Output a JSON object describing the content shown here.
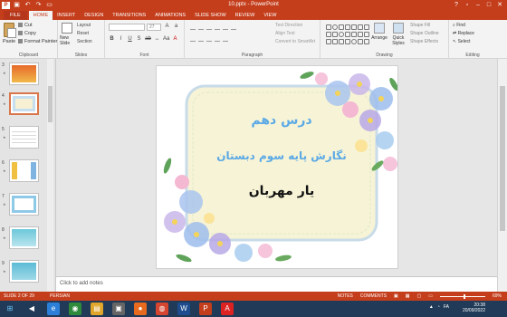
{
  "window": {
    "title": "10.pptx - PowerPoint"
  },
  "tabs": [
    {
      "label": "FILE"
    },
    {
      "label": "HOME"
    },
    {
      "label": "INSERT"
    },
    {
      "label": "DESIGN"
    },
    {
      "label": "TRANSITIONS"
    },
    {
      "label": "ANIMATIONS"
    },
    {
      "label": "SLIDE SHOW"
    },
    {
      "label": "REVIEW"
    },
    {
      "label": "VIEW"
    }
  ],
  "ribbon": {
    "clipboard": {
      "paste": "Paste",
      "cut": "Cut",
      "copy": "Copy",
      "format_painter": "Format Painter",
      "label": "Clipboard"
    },
    "slides": {
      "new_slide": "New Slide",
      "layout": "Layout",
      "reset": "Reset",
      "section": "Section",
      "label": "Slides"
    },
    "font": {
      "size": "27",
      "label": "Font"
    },
    "paragraph": {
      "text_direction": "Text Direction",
      "align_text": "Align Text",
      "smartart": "Convert to SmartArt",
      "label": "Paragraph"
    },
    "drawing": {
      "arrange": "Arrange",
      "quick_styles": "Quick Styles",
      "shape_fill": "Shape Fill",
      "shape_outline": "Shape Outline",
      "shape_effects": "Shape Effects",
      "label": "Drawing"
    },
    "editing": {
      "find": "Find",
      "replace": "Replace",
      "select": "Select",
      "label": "Editing"
    }
  },
  "thumbnails": [
    {
      "num": "3"
    },
    {
      "num": "4"
    },
    {
      "num": "5"
    },
    {
      "num": "6"
    },
    {
      "num": "7"
    },
    {
      "num": "8"
    },
    {
      "num": "9"
    }
  ],
  "slide": {
    "line1": "درس دهم",
    "line2": "نگارش پایه سوم دبستان",
    "line3": "یار مهربان",
    "title_color": "#5aa9e6",
    "name_color": "#111111"
  },
  "notes": {
    "placeholder": "Click to add notes"
  },
  "status": {
    "slide": "SLIDE 2 OF 29",
    "language": "PERSIAN",
    "notes": "NOTES",
    "comments": "COMMENTS",
    "zoom": "69%"
  },
  "taskbar": {
    "lang": "FA",
    "time": "20:38",
    "date": "20/09/2022"
  },
  "colors": {
    "accent": "#c43e1c"
  }
}
